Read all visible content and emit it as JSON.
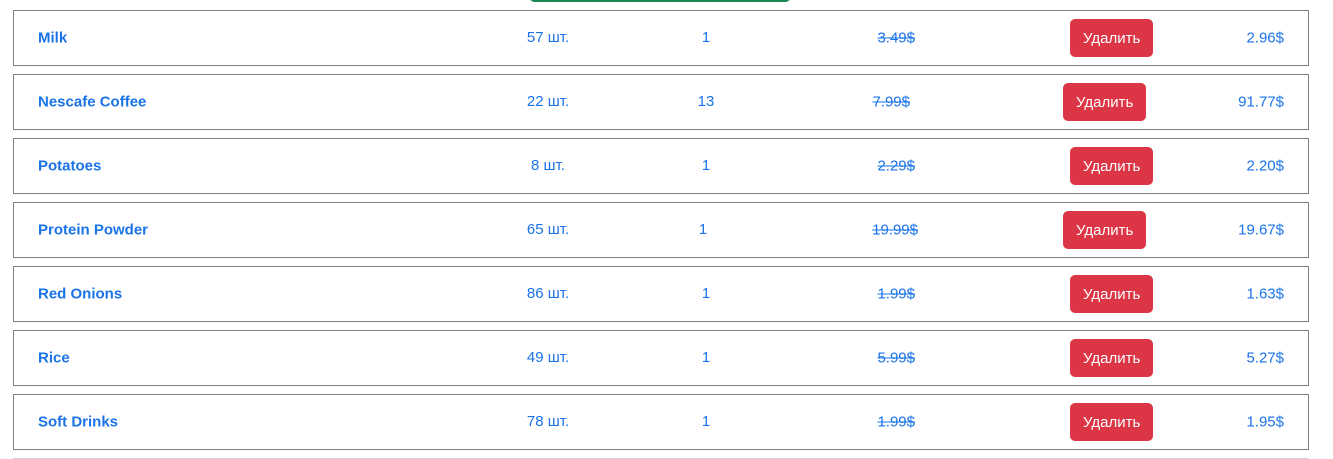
{
  "colors": {
    "link_blue": "#1a73e8",
    "danger_red": "#dc3545",
    "success_green": "#198754",
    "border_gray": "#7f7f7f"
  },
  "cart": {
    "items": [
      {
        "name": "Milk",
        "stock": "57 шт.",
        "quantity": "1",
        "old_price": "3.49$",
        "delete_label": "Удалить",
        "total": "2.96$"
      },
      {
        "name": "Nescafe Coffee",
        "stock": "22 шт.",
        "quantity": "13",
        "old_price": "7.99$",
        "delete_label": "Удалить",
        "total": "91.77$"
      },
      {
        "name": "Potatoes",
        "stock": "8 шт.",
        "quantity": "1",
        "old_price": "2.29$",
        "delete_label": "Удалить",
        "total": "2.20$"
      },
      {
        "name": "Protein Powder",
        "stock": "65 шт.",
        "quantity": "1",
        "old_price": "19.99$",
        "delete_label": "Удалить",
        "total": "19.67$"
      },
      {
        "name": "Red Onions",
        "stock": "86 шт.",
        "quantity": "1",
        "old_price": "1.99$",
        "delete_label": "Удалить",
        "total": "1.63$"
      },
      {
        "name": "Rice",
        "stock": "49 шт.",
        "quantity": "1",
        "old_price": "5.99$",
        "delete_label": "Удалить",
        "total": "5.27$"
      },
      {
        "name": "Soft Drinks",
        "stock": "78 шт.",
        "quantity": "1",
        "old_price": "1.99$",
        "delete_label": "Удалить",
        "total": "1.95$"
      }
    ]
  }
}
